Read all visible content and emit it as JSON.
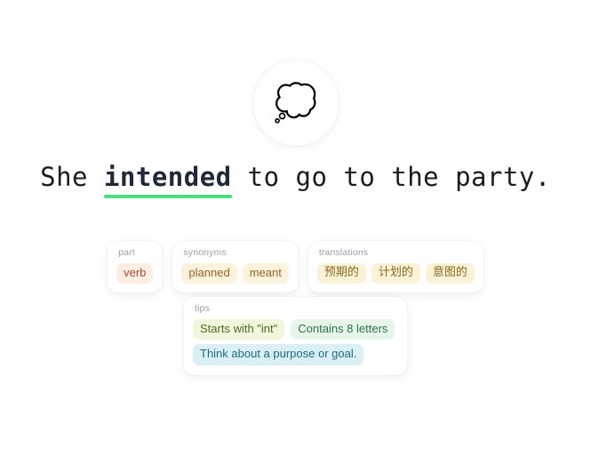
{
  "medallion": {
    "icon_name": "thought-balloon-icon",
    "glyph": "💭"
  },
  "sentence": {
    "prefix": "She ",
    "target_word": "intended",
    "suffix": " to go to the party.",
    "full_text": "She intended to go to the party.",
    "underline_color": "#4ade80",
    "text_color": "#1b1d21"
  },
  "meta_cards": [
    {
      "label": "part",
      "chip_style": "chip-pos",
      "chips": [
        "verb"
      ],
      "accent": "#b4472c",
      "chip_bg": "#fdeee4"
    },
    {
      "label": "synonyms",
      "chip_style": "chip-syn",
      "chips": [
        "planned",
        "meant"
      ],
      "accent": "#9a6322",
      "chip_bg": "#fdf3dc"
    },
    {
      "label": "translations",
      "chip_style": "chip-trans",
      "chips": [
        "预期的",
        "计划的",
        "意图的"
      ],
      "accent": "#8b6a1e",
      "chip_bg": "#fbf2d8"
    }
  ],
  "tips": {
    "label": "tips",
    "rows": [
      [
        {
          "text": "Starts with \"int\"",
          "style": "chip-tip-a",
          "accent": "#4b6b20",
          "chip_bg": "#f1f7dc"
        },
        {
          "text": "Contains 8 letters",
          "style": "chip-tip-b",
          "accent": "#2f7347",
          "chip_bg": "#e6f6ea"
        }
      ],
      [
        {
          "text": "Think about a purpose or goal.",
          "style": "chip-tip-c",
          "accent": "#1d6b7e",
          "chip_bg": "#daf0f6"
        }
      ]
    ]
  }
}
